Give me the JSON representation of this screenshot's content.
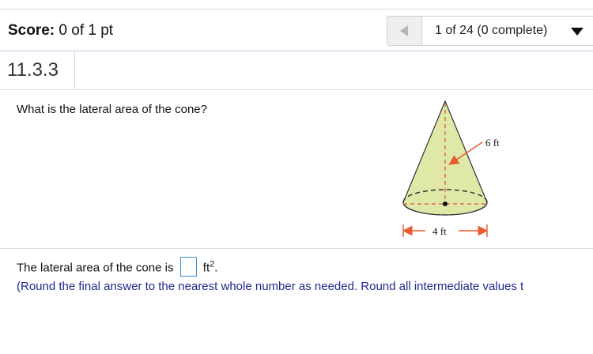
{
  "header": {
    "score_label": "Score:",
    "score_value": "0 of 1 pt",
    "progress": "1 of 24 (0 complete)"
  },
  "question": {
    "id": "11.3.3",
    "prompt": "What is the lateral area of the cone?",
    "figure": {
      "slant_label": "6 ft",
      "diameter_label": "4 ft"
    },
    "answer": {
      "prefix": "The lateral area of the cone is",
      "value": "",
      "unit": "ft",
      "unit_exp": "2",
      "suffix": "."
    },
    "note": "(Round the final answer to the nearest whole number as needed.  Round all intermediate values t"
  },
  "colors": {
    "cone_fill": "#dfe8a6",
    "dash_red": "#e2533d",
    "arrow_orange": "#e65c2e",
    "note_blue": "#1f2a8a",
    "input_border": "#3b8fd6"
  },
  "icons": {
    "prev": "triangle-left-icon",
    "dropdown": "caret-down-icon"
  }
}
